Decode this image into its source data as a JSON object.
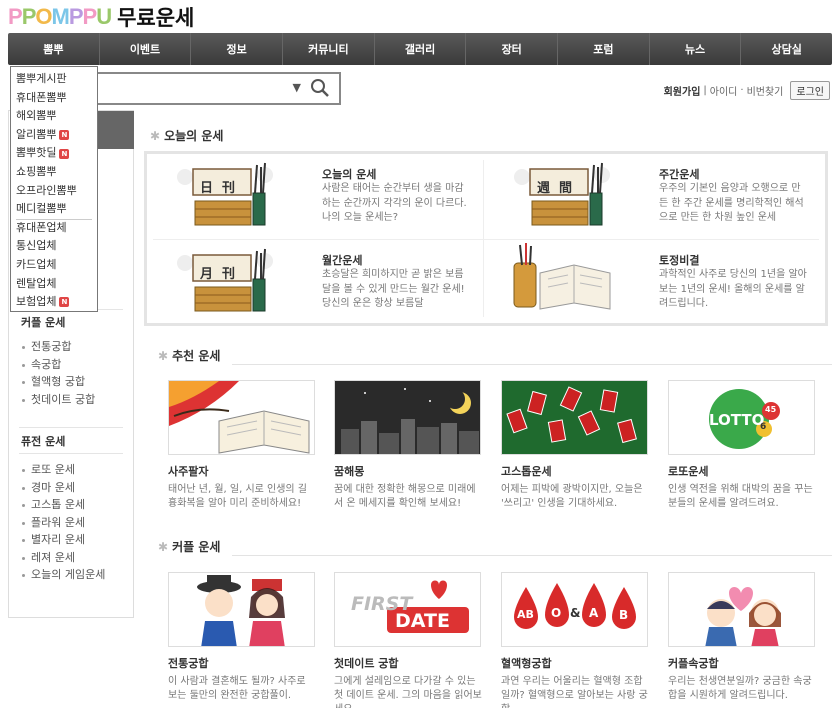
{
  "header": {
    "logo_text": "PPOMPPU",
    "logo_letters": [
      "P",
      "P",
      "O",
      "M",
      "P",
      "P",
      "U"
    ],
    "section_title": "무료운세"
  },
  "gnb": [
    "뽐뿌",
    "이벤트",
    "정보",
    "커뮤니티",
    "갤러리",
    "장터",
    "포럼",
    "뉴스",
    "상담실"
  ],
  "dropdown": [
    {
      "label": "뽐뿌게시판",
      "badge": ""
    },
    {
      "label": "휴대폰뽐뿌",
      "badge": ""
    },
    {
      "label": "해외뽐뿌",
      "badge": ""
    },
    {
      "label": "알리뽐뿌",
      "badge": "N"
    },
    {
      "label": "뽐뿌핫딜",
      "badge": "N"
    },
    {
      "label": "쇼핑뽐뿌",
      "badge": ""
    },
    {
      "label": "오프라인뽐뿌",
      "badge": ""
    },
    {
      "label": "메디컬뽐뿌",
      "badge": ""
    },
    {
      "label": "휴대폰업체",
      "badge": ""
    },
    {
      "label": "통신업체",
      "badge": ""
    },
    {
      "label": "카드업체",
      "badge": ""
    },
    {
      "label": "렌탈업체",
      "badge": ""
    },
    {
      "label": "보험업체",
      "badge": "N"
    }
  ],
  "search": {
    "value": "",
    "placeholder": ""
  },
  "member": {
    "join": "회원가입",
    "id": "아이디",
    "pw": "비번찾기",
    "login": "로그인"
  },
  "sidebar": {
    "couple": {
      "title": "커플 운세",
      "items": [
        "전통궁합",
        "속궁합",
        "혈액형 궁합",
        "첫데이트 궁합"
      ]
    },
    "fusion": {
      "title": "퓨전 운세",
      "items": [
        "로또 운세",
        "경마 운세",
        "고스톱 운세",
        "플라워 운세",
        "별자리 운세",
        "레져 운세",
        "오늘의 게임운세"
      ]
    }
  },
  "today": {
    "title": "오늘의 운세",
    "cards": [
      {
        "title": "오늘의 운세",
        "desc": "사람은 태어는 순간부터 생을 마감하는 순간까지 각각의 운이 다르다. 나의 오늘 운세는?"
      },
      {
        "title": "주간운세",
        "desc": "우주의 기본인 음양과 오행으로 만든 한 주간 운세를 명리학적인 해석으로 만든 한 차원 높인 운세"
      },
      {
        "title": "월간운세",
        "desc": "초승달은 희미하지만 곧 밝은 보름달을 볼 수 있게 만드는 월간 운세! 당신의 운은 항상 보름달"
      },
      {
        "title": "토정비결",
        "desc": "과학적인 사주로 당신의 1년을 알아보는 1년의 운세! 올해의 운세를 알려드립니다."
      }
    ],
    "seals": [
      "日",
      "刊",
      "週",
      "間",
      "月",
      "刊"
    ]
  },
  "recommend": {
    "title": "추천 운세",
    "cards": [
      {
        "title": "사주팔자",
        "desc": "태어난 년, 월, 일, 시로 인생의 길흉화복을 알아 미리 준비하세요!"
      },
      {
        "title": "꿈해몽",
        "desc": "꿈에 대한 정확한 해몽으로 미래에서 온 메세지를 확인해 보세요!"
      },
      {
        "title": "고스톱운세",
        "desc": "어제는 피박에 광박이지만, 오늘은 '쓰리고' 인생을 기대하세요."
      },
      {
        "title": "로또운세",
        "desc": "인생 역전을 위해 대박의 꿈을 꾸는 분들의 운세를 알려드려요."
      }
    ],
    "lotto_text": "LOTTO",
    "lotto_num": "45",
    "lotto_six": "6"
  },
  "couple": {
    "title": "커플 운세",
    "cards": [
      {
        "title": "전통궁합",
        "desc": "이 사람과 결혼해도 될까? 사주로 보는 둘만의 완전한 궁합풀이."
      },
      {
        "title": "첫데이트 궁합",
        "desc": "그에게 설레임으로 다가갈 수 있는 첫 데이트 운세. 그의 마음을 읽어보세요."
      },
      {
        "title": "혈액형궁합",
        "desc": "과연 우리는 어울리는 혈액형 조합일까? 혈액형으로 알아보는 사랑 궁합."
      },
      {
        "title": "커플속궁합",
        "desc": "우리는 천생연분일까? 궁금한 속궁합을 시원하게 알려드립니다."
      }
    ],
    "first": "FIRST",
    "date": "DATE",
    "blood": [
      "AB",
      "O",
      "&",
      "A",
      "B"
    ]
  },
  "colors": {
    "nav": "#444444",
    "badge": "#e04646",
    "accent_red": "#d62828"
  }
}
